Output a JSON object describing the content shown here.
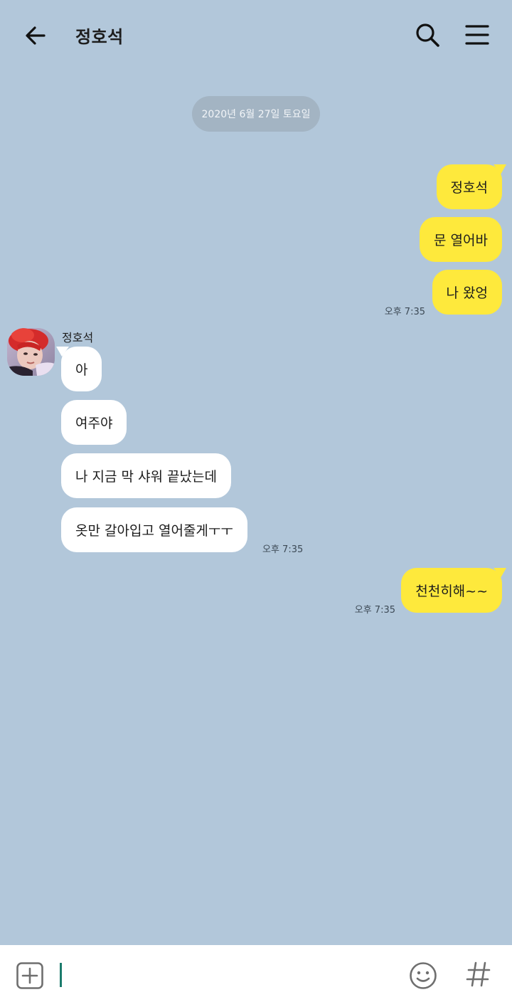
{
  "header": {
    "title": "정호석"
  },
  "date_divider": "2020년 6월 27일 토요일",
  "messages": [
    {
      "from": "me",
      "text": "정호석"
    },
    {
      "from": "me",
      "text": "문 열어바"
    },
    {
      "from": "me",
      "text": "나 왔엉",
      "time": "오후 7:35"
    },
    {
      "from": "other",
      "sender": "정호석",
      "text": "아"
    },
    {
      "from": "other",
      "text": "여주야"
    },
    {
      "from": "other",
      "text": "나 지금 막 샤워 끝났는데"
    },
    {
      "from": "other",
      "text": "옷만 갈아입고 열어줄게ㅜㅜ",
      "time": "오후 7:35"
    },
    {
      "from": "me",
      "text": "천천히해~~",
      "time": "오후 7:35"
    }
  ],
  "input": {
    "value": "",
    "placeholder": ""
  },
  "colors": {
    "background": "#b2c7da",
    "my_bubble": "#fee93c",
    "other_bubble": "#ffffff",
    "date_pill": "#a3b4c3",
    "cursor": "#1b7b6c"
  },
  "icons": {
    "back": "arrow-left-icon",
    "search": "search-icon",
    "menu": "hamburger-menu-icon",
    "attach": "plus-square-icon",
    "emoji": "smiley-icon",
    "hashtag": "hashtag-icon"
  }
}
